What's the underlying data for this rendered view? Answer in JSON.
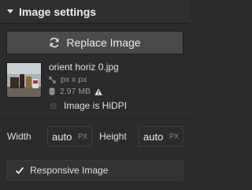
{
  "section": {
    "title": "Image settings",
    "expanded": true
  },
  "replace_button": {
    "label": "Replace Image",
    "icon": "refresh-icon"
  },
  "image": {
    "filename": "orient horiz 0.jpg",
    "dimensions": "px x px",
    "filesize": "2.97 MB",
    "warning_icon": "warning-icon",
    "hidpi_label": "Image is HiDPI",
    "hidpi_checked": false
  },
  "size": {
    "width_label": "Width",
    "width_value": "auto",
    "width_unit": "PX",
    "height_label": "Height",
    "height_value": "auto",
    "height_unit": "PX"
  },
  "responsive": {
    "label": "Responsive Image",
    "checked": true
  },
  "colors": {
    "panel_bg": "#2b2b2b",
    "button_bg": "#4a4a4a",
    "text": "#e0e0e0",
    "muted_text": "#9a9a9a"
  }
}
